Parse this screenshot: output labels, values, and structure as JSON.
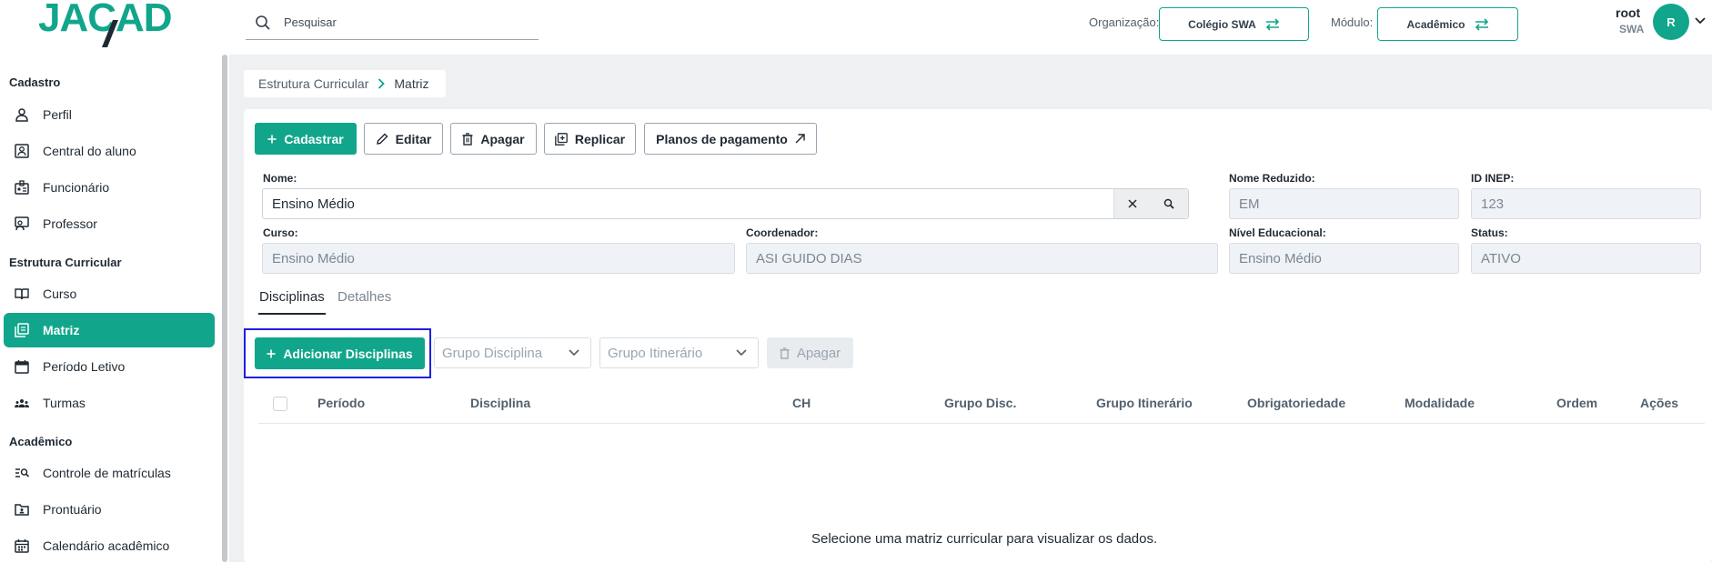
{
  "header": {
    "logo_text": "JACAD",
    "search_placeholder": "Pesquisar",
    "org_label": "Organização:",
    "org_value": "Colégio SWA",
    "module_label": "Módulo:",
    "module_value": "Acadêmico",
    "user_name": "root",
    "user_org": "SWA",
    "avatar_letter": "R"
  },
  "sidebar": {
    "sections": [
      {
        "title": "Cadastro",
        "items": [
          "Perfil",
          "Central do aluno",
          "Funcionário",
          "Professor"
        ]
      },
      {
        "title": "Estrutura Curricular",
        "items": [
          "Curso",
          "Matriz",
          "Período Letivo",
          "Turmas"
        ]
      },
      {
        "title": "Acadêmico",
        "items": [
          "Controle de matrículas",
          "Prontuário",
          "Calendário acadêmico"
        ]
      }
    ],
    "active_item": "Matriz"
  },
  "breadcrumb": {
    "parent": "Estrutura Curricular",
    "current": "Matriz"
  },
  "toolbar": {
    "cadastrar": "Cadastrar",
    "editar": "Editar",
    "apagar": "Apagar",
    "replicar": "Replicar",
    "planos": "Planos de pagamento"
  },
  "form": {
    "nome_label": "Nome:",
    "nome_value": "Ensino Médio",
    "nome_reduzido_label": "Nome Reduzido:",
    "nome_reduzido_value": "EM",
    "id_inep_label": "ID INEP:",
    "id_inep_value": "123",
    "curso_label": "Curso:",
    "curso_value": "Ensino Médio",
    "coordenador_label": "Coordenador:",
    "coordenador_value": "ASI GUIDO DIAS",
    "nivel_label": "Nível Educacional:",
    "nivel_value": "Ensino Médio",
    "status_label": "Status:",
    "status_value": "ATIVO"
  },
  "tabs": {
    "disciplinas": "Disciplinas",
    "detalhes": "Detalhes"
  },
  "disciplinas_toolbar": {
    "adicionar": "Adicionar Disciplinas",
    "grupo_disciplina_placeholder": "Grupo Disciplina",
    "grupo_itinerario_placeholder": "Grupo Itinerário",
    "apagar": "Apagar"
  },
  "table": {
    "columns": [
      "Período",
      "Disciplina",
      "CH",
      "Grupo Disc.",
      "Grupo Itinerário",
      "Obrigatoriedade",
      "Modalidade",
      "Ordem",
      "Ações"
    ],
    "empty_message": "Selecione uma matriz curricular para visualizar os dados."
  },
  "colors": {
    "accent": "#11a68b",
    "highlight_border": "#1f1fe0"
  }
}
